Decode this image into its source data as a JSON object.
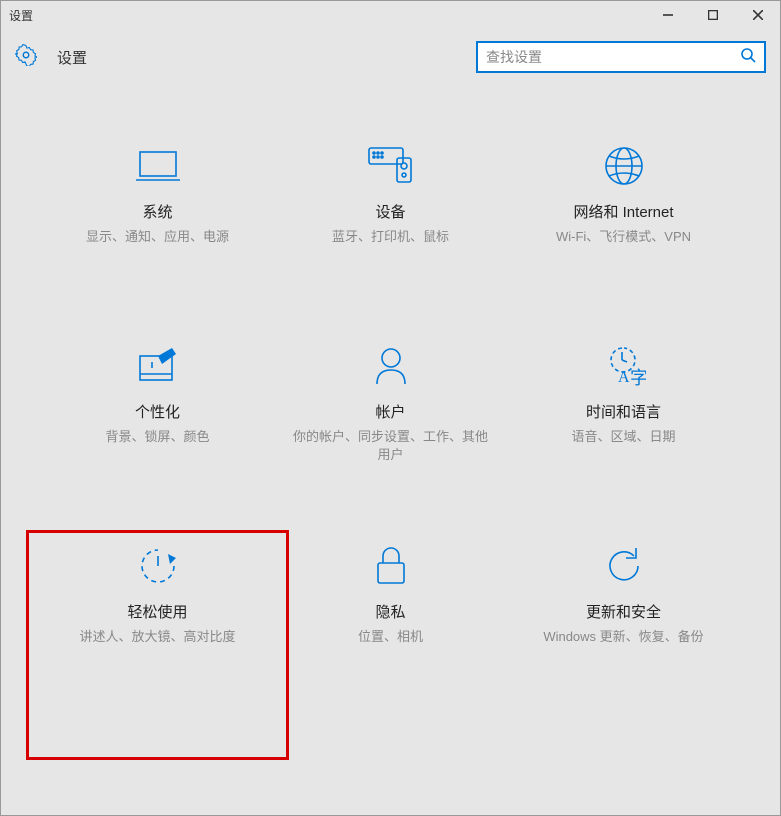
{
  "window": {
    "title": "设置"
  },
  "header": {
    "title": "设置"
  },
  "search": {
    "placeholder": "查找设置"
  },
  "tiles": {
    "system": {
      "title": "系统",
      "sub": "显示、通知、应用、电源"
    },
    "devices": {
      "title": "设备",
      "sub": "蓝牙、打印机、鼠标"
    },
    "network": {
      "title": "网络和 Internet",
      "sub": "Wi-Fi、飞行模式、VPN"
    },
    "personalization": {
      "title": "个性化",
      "sub": "背景、锁屏、颜色"
    },
    "accounts": {
      "title": "帐户",
      "sub": "你的帐户、同步设置、工作、其他用户"
    },
    "time": {
      "title": "时间和语言",
      "sub": "语音、区域、日期"
    },
    "ease": {
      "title": "轻松使用",
      "sub": "讲述人、放大镜、高对比度"
    },
    "privacy": {
      "title": "隐私",
      "sub": "位置、相机"
    },
    "update": {
      "title": "更新和安全",
      "sub": "Windows 更新、恢复、备份"
    }
  }
}
